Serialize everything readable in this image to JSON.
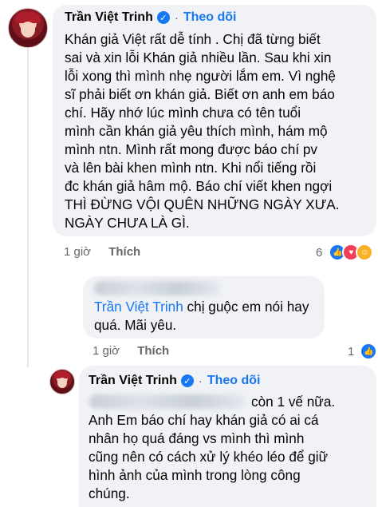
{
  "comment1": {
    "author": "Trần Việt Trinh",
    "follow_label": "Theo dõi",
    "dot": "·",
    "lines": [
      "Khán giả Việt rất dễ tính . Chị đã từng biết",
      "sai và xin lỗi Khán giả nhiều lần. Sau khi xin",
      "lỗi xong thì mình nhẹ người lắm em. Vì nghệ",
      "sĩ phải biết ơn khán giả. Biết ơn anh em báo",
      "chí. Hãy nhớ lúc mình chưa có tên tuổi",
      "mình cần khán giả yêu thích mình, hám mộ",
      "mình ntn. Mình rất mong được báo chí pv",
      "và lên bài khen mình ntn. Khi nổi tiếng rồi",
      "đc khán giả hâm mộ. Báo chí viết khen ngợi",
      "THÌ ĐỪNG VỘI QUÊN NHỮNG NGÀY XƯA.",
      "NGÀY CHƯA LÀ GÌ."
    ],
    "time": "1 giờ",
    "like_label": "Thích",
    "reaction_count": "6"
  },
  "reply1": {
    "tagged_name": "Trần Việt Trinh",
    "line1_rest": " chị guộc em nói hay",
    "line2": "quá. Mãi yêu.",
    "time": "1 giờ",
    "like_label": "Thích",
    "reaction_count": "1"
  },
  "comment2": {
    "author": "Trần Việt Trinh",
    "follow_label": "Theo dõi",
    "dot": "·",
    "line1_rest": "còn 1 vế nữa.",
    "lines": [
      "Anh Em báo chí hay khán giả có ai cá",
      "nhân họ quá đáng vs mình thì mình",
      "cũng nên có cách xử lý khéo léo để  giữ",
      "hình ảnh của mình trong lòng công",
      "chúng."
    ]
  },
  "colors": {
    "accent": "#1877f2",
    "bubble": "#f0f2f5",
    "meta": "#65676b"
  }
}
